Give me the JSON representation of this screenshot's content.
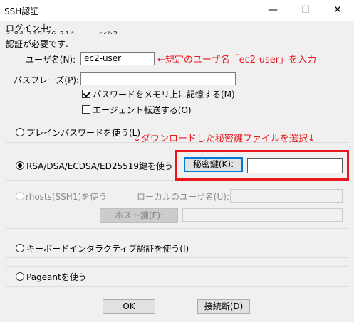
{
  "window": {
    "title": "SSH認証",
    "minimize": "—",
    "maximize": "☐",
    "close": "✕"
  },
  "login": {
    "label": "ログイン中:",
    "host_partial": "3.84.215.76.214 ... ...ssh2...",
    "auth_required": "認証が必要です."
  },
  "user": {
    "label": "ユーザ名(N):",
    "value": "ec2-user",
    "annotation": "←規定のユーザ名「ec2-user」を入力"
  },
  "passphrase": {
    "label": "パスフレーズ(P):",
    "value": ""
  },
  "checkboxes": {
    "save_password": {
      "label": "パスワードをメモリ上に記憶する(M)",
      "checked": true
    },
    "agent_forward": {
      "label": "エージェント転送する(O)",
      "checked": false
    }
  },
  "methods": {
    "plain": {
      "label": "プレインパスワードを使う(L)"
    },
    "rsa": {
      "label": "RSA/DSA/ECDSA/ED25519鍵を使う",
      "private_key_button": "秘密鍵(K):",
      "key_value": ""
    },
    "rhosts": {
      "label": "rhosts(SSH1)を使う",
      "local_user_label": "ローカルのユーザ名(U):",
      "host_key_button": "ホスト鍵(F):"
    },
    "keyboard": {
      "label": "キーボードインタラクティブ認証を使う(I)"
    },
    "pageant": {
      "label": "Pageantを使う"
    }
  },
  "annotation_key": "↓ダウンロードした秘密鍵ファイルを選択↓",
  "buttons": {
    "ok": "OK",
    "disconnect": "接続断(D)"
  },
  "colors": {
    "annotation_red": "#e8171c",
    "focus_blue": "#0078d7"
  }
}
